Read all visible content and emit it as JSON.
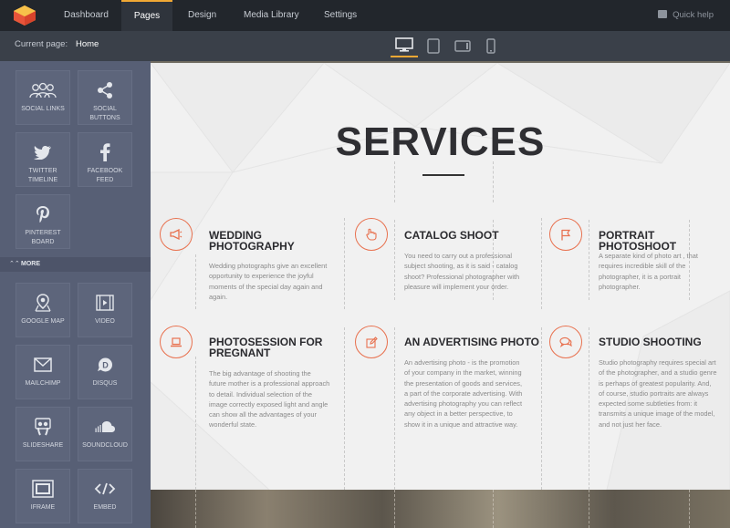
{
  "nav": {
    "items": [
      "Dashboard",
      "Pages",
      "Design",
      "Media Library",
      "Settings"
    ],
    "active": "Pages",
    "quick_help": "Quick help"
  },
  "subbar": {
    "current_label": "Current page:",
    "current_value": "Home",
    "devices": [
      "desktop-icon",
      "tablet-icon",
      "tablet-landscape-icon",
      "mobile-icon"
    ]
  },
  "sidebar": {
    "tiles_top": [
      {
        "label": "SOCIAL LINKS",
        "icon": "people-icon"
      },
      {
        "label": "SOCIAL BUTTONS",
        "icon": "share-icon"
      },
      {
        "label": "TWITTER TIMELINE",
        "icon": "twitter-icon"
      },
      {
        "label": "FACEBOOK FEED",
        "icon": "facebook-icon"
      },
      {
        "label": "PINTEREST BOARD",
        "icon": "pinterest-icon"
      }
    ],
    "more": "MORE",
    "tiles_more": [
      {
        "label": "GOOGLE MAP",
        "icon": "map-pin-icon"
      },
      {
        "label": "VIDEO",
        "icon": "video-icon"
      },
      {
        "label": "MAILCHIMP",
        "icon": "mail-icon"
      },
      {
        "label": "DISQUS",
        "icon": "disqus-icon"
      },
      {
        "label": "SLIDESHARE",
        "icon": "slideshare-icon"
      },
      {
        "label": "SOUNDCLOUD",
        "icon": "soundcloud-icon"
      },
      {
        "label": "IFRAME",
        "icon": "iframe-icon"
      },
      {
        "label": "EMBED",
        "icon": "code-icon"
      }
    ]
  },
  "content": {
    "title": "SERVICES",
    "services": [
      {
        "title_line1": "WEDDING",
        "title_line2": "PHOTOGRAPHY",
        "desc": [
          "Wedding photographs give an excellent",
          "opportunity to experience the joyful",
          "moments of the special day again and",
          "again."
        ],
        "icon": "megaphone-icon"
      },
      {
        "title_line1": "CATALOG SHOOT",
        "title_line2": "",
        "desc": [
          "You need to carry out a professional",
          "subject shooting, as it is said - catalog",
          "shoot? Professional photographer with",
          "pleasure will implement your order."
        ],
        "icon": "hand-icon"
      },
      {
        "title_line1": "PORTRAIT PHOTOSHOOT",
        "title_line2": "",
        "desc": [
          "A separate kind of photo art , that",
          "requires incredible skill of the",
          "photographer, it is a portrait",
          "photographer."
        ],
        "icon": "flag-icon"
      },
      {
        "title_line1": "PHOTOSESSION FOR",
        "title_line2": "PREGNANT",
        "desc": [
          "The big advantage of shooting the",
          "future mother is a professional approach",
          "to detail. Individual selection of the",
          "image correctly exposed light and angle",
          "can show all the advantages of your",
          "wonderful state."
        ],
        "icon": "laptop-icon"
      },
      {
        "title_line1": "AN ADVERTISING PHOTO",
        "title_line2": "",
        "desc": [
          "An advertising photo - is the promotion",
          "of your company in the market, winning",
          "the presentation of goods and services,",
          "a part of the corporate advertising. With",
          "advertising photography you can reflect",
          "any object in a better perspective, to",
          "show it in a unique and attractive way."
        ],
        "icon": "edit-icon"
      },
      {
        "title_line1": "STUDIO SHOOTING",
        "title_line2": "",
        "desc": [
          "Studio photography requires special art",
          "of the photographer, and a studio genre",
          "is perhaps of greatest popularity. And,",
          "of course, studio portraits are always",
          "expected some subtleties from: it",
          "transmits a unique image of the model,",
          "and not just her face."
        ],
        "icon": "chat-icon"
      }
    ]
  },
  "colors": {
    "accent": "#f0a834",
    "icon_orange": "#e8714f",
    "sidebar": "#575f75",
    "topbar": "#22262c"
  }
}
